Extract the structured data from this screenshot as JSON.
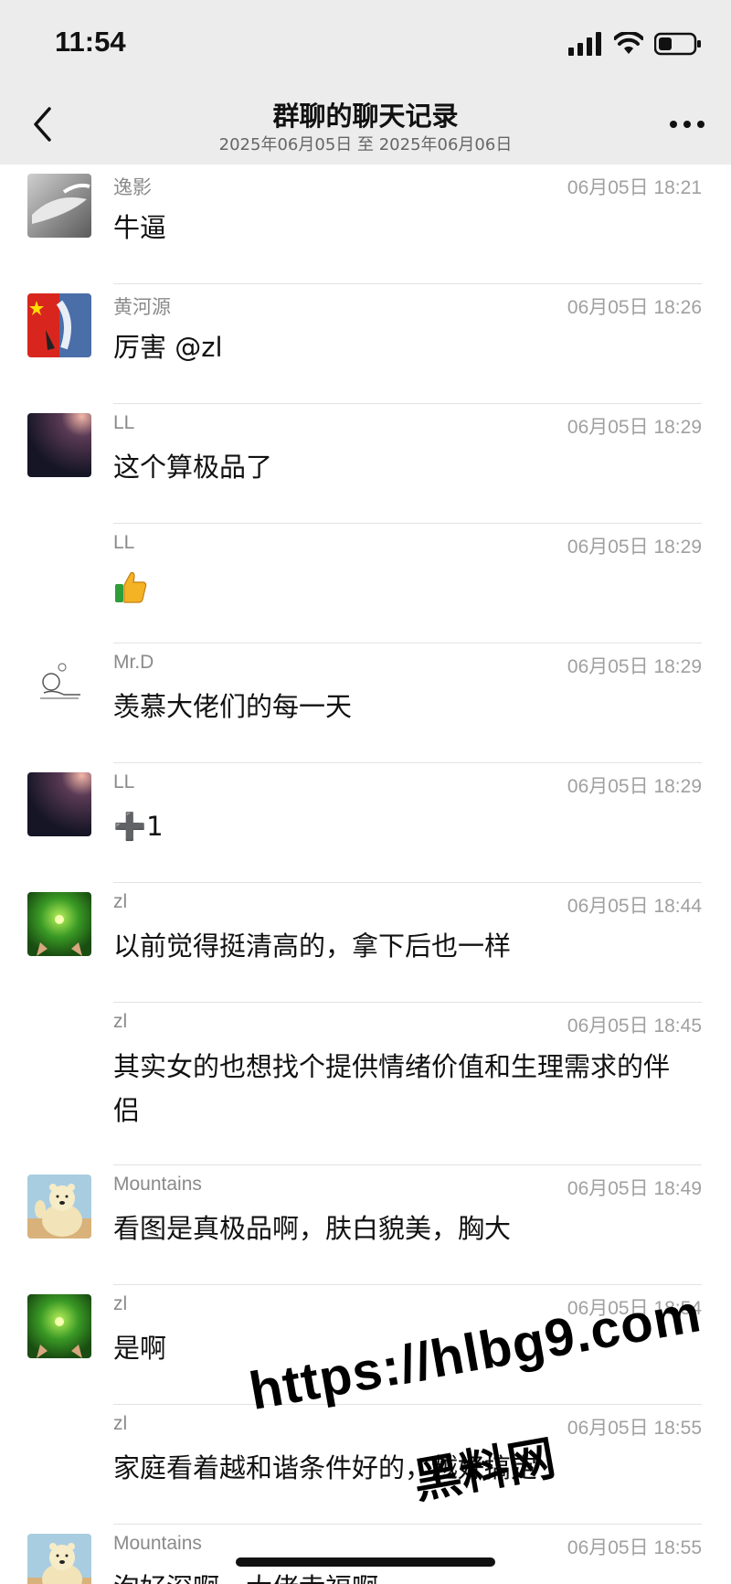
{
  "status_bar": {
    "time": "11:54"
  },
  "header": {
    "title": "群聊的聊天记录",
    "subtitle": "2025年06月05日 至 2025年06月06日"
  },
  "messages": [
    {
      "sender": "逸影",
      "time": "06月05日 18:21",
      "text": "牛逼",
      "avatar": "avatar-fish"
    },
    {
      "sender": "黄河源",
      "time": "06月05日 18:26",
      "text": "厉害 @zl",
      "avatar": "avatar-flag"
    },
    {
      "sender": "LL",
      "time": "06月05日 18:29",
      "text": "这个算极品了",
      "avatar": "avatar-planet"
    },
    {
      "sender": "LL",
      "time": "06月05日 18:29",
      "text": "",
      "avatar": "",
      "emoji": "thumbs-up-icon"
    },
    {
      "sender": "Mr.D",
      "time": "06月05日 18:29",
      "text": "羡慕大佬们的每一天",
      "avatar": "avatar-sketch"
    },
    {
      "sender": "LL",
      "time": "06月05日 18:29",
      "text": "➕1",
      "avatar": "avatar-planet"
    },
    {
      "sender": "zl",
      "time": "06月05日 18:44",
      "text": "以前觉得挺清高的，拿下后也一样",
      "avatar": "avatar-green"
    },
    {
      "sender": "zl",
      "time": "06月05日 18:45",
      "text": "其实女的也想找个提供情绪价值和生理需求的伴侣",
      "avatar": ""
    },
    {
      "sender": "Mountains",
      "time": "06月05日 18:49",
      "text": "看图是真极品啊，肤白貌美，胸大",
      "avatar": "avatar-bear"
    },
    {
      "sender": "zl",
      "time": "06月05日 18:54",
      "text": "是啊",
      "avatar": "avatar-green"
    },
    {
      "sender": "zl",
      "time": "06月05日 18:55",
      "text": "家庭看着越和谐条件好的，越好搞定",
      "avatar": ""
    },
    {
      "sender": "Mountains",
      "time": "06月05日 18:55",
      "text": "泡好深啊，大佬幸福啊",
      "avatar": "avatar-bear"
    }
  ],
  "watermark": {
    "url": "https://hlbg9.com",
    "label": "黑料网"
  },
  "colors": {
    "header_bg": "#ececec",
    "divider": "#e2e2e2",
    "meta_text": "#a0a0a0"
  }
}
